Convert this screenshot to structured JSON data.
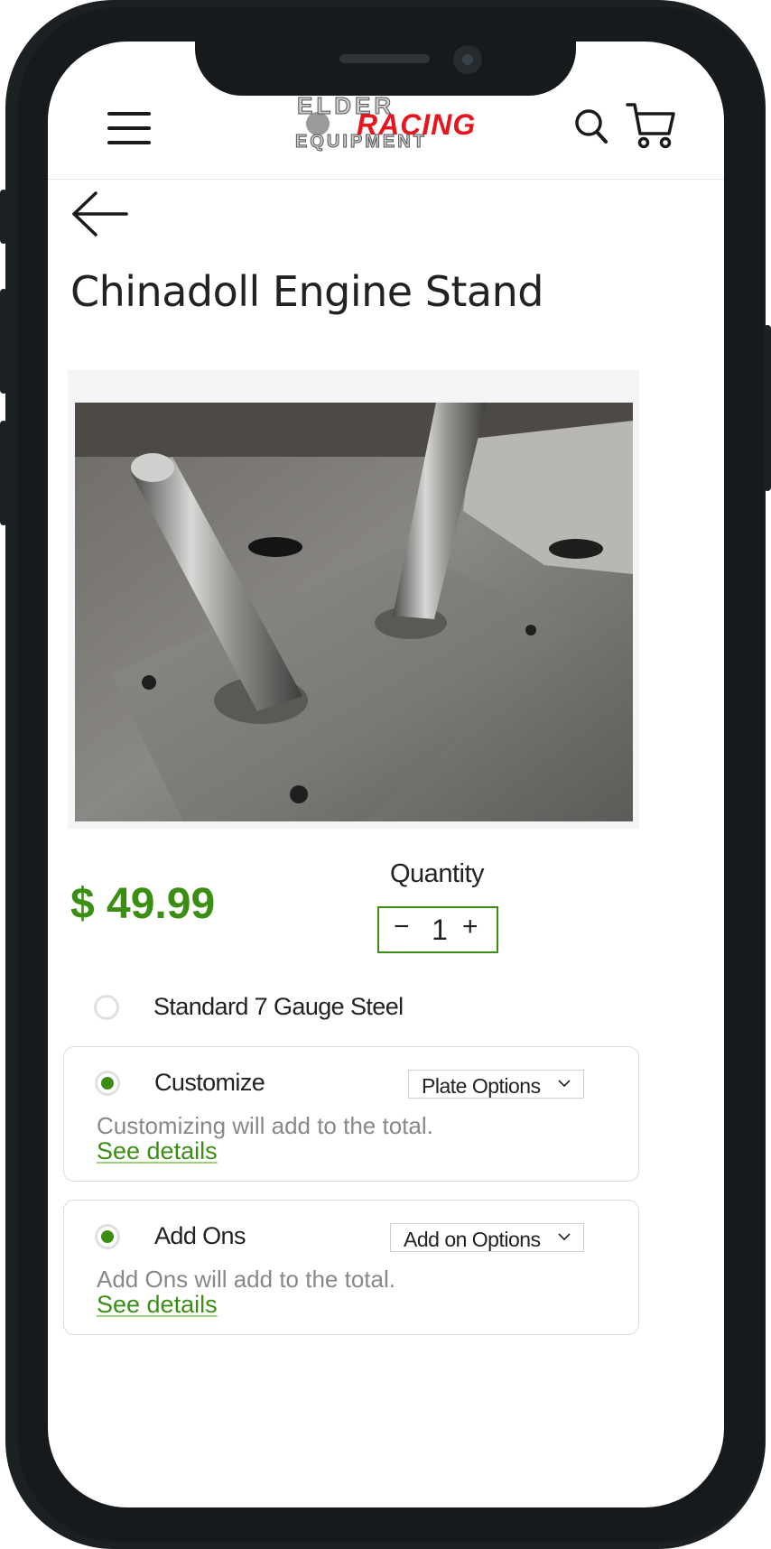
{
  "header": {
    "menu_icon": "hamburger-menu-icon",
    "logo": {
      "line1": "ELDER",
      "line2": "RACING",
      "line3": "EQUIPMENT"
    },
    "search_icon": "search-icon",
    "cart_icon": "cart-icon"
  },
  "nav": {
    "back_icon": "arrow-left-icon"
  },
  "product": {
    "title": "Chinadoll Engine Stand",
    "price": "$ 49.99",
    "quantity_label": "Quantity",
    "quantity_value": "1",
    "minus": "−",
    "plus": "+"
  },
  "options": [
    {
      "label": "Standard 7 Gauge Steel",
      "selected": false
    },
    {
      "label": "Customize",
      "selected": true,
      "select_value": "Plate Options",
      "note": "Customizing will add to the total.",
      "link": "See details"
    },
    {
      "label": "Add Ons",
      "selected": true,
      "select_value": "Add on Options",
      "note": "Add Ons will add to the total.",
      "link": "See details"
    }
  ],
  "colors": {
    "accent": "#3a8f13",
    "logo_red": "#e5161d"
  }
}
